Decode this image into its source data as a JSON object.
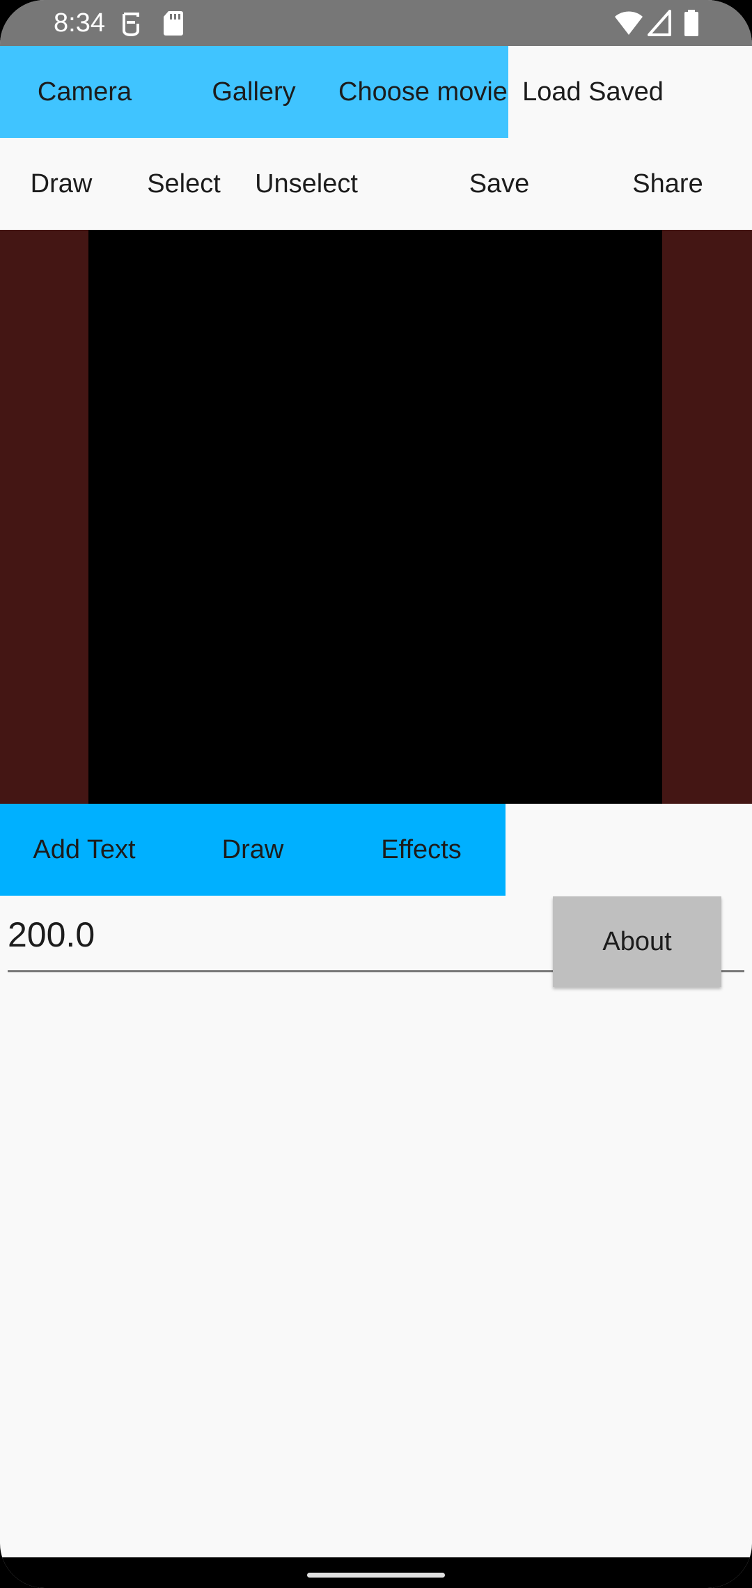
{
  "status_bar": {
    "time": "8:34"
  },
  "top_row": {
    "camera": "Camera",
    "gallery": "Gallery",
    "choose_movie": "Choose movie",
    "load_saved": "Load Saved"
  },
  "tool_row": {
    "draw": "Draw",
    "select": "Select",
    "unselect": "Unselect",
    "save": "Save",
    "share": "Share"
  },
  "bottom_tabs": {
    "add_text": "Add Text",
    "draw": "Draw",
    "effects": "Effects"
  },
  "value_field": {
    "value": "200.0"
  },
  "about": {
    "label": "About"
  },
  "colors": {
    "top_row_accent": "#40c4ff",
    "bottom_tabs_accent": "#00b0ff",
    "canvas_border": "#441614",
    "canvas": "#000000",
    "about_button": "#bfbfbf",
    "status_bar": "#777777"
  },
  "icons": {
    "status_left": [
      "face-unlock-icon",
      "sd-card-icon"
    ],
    "status_right": [
      "wifi-icon",
      "signal-icon",
      "battery-icon"
    ]
  }
}
